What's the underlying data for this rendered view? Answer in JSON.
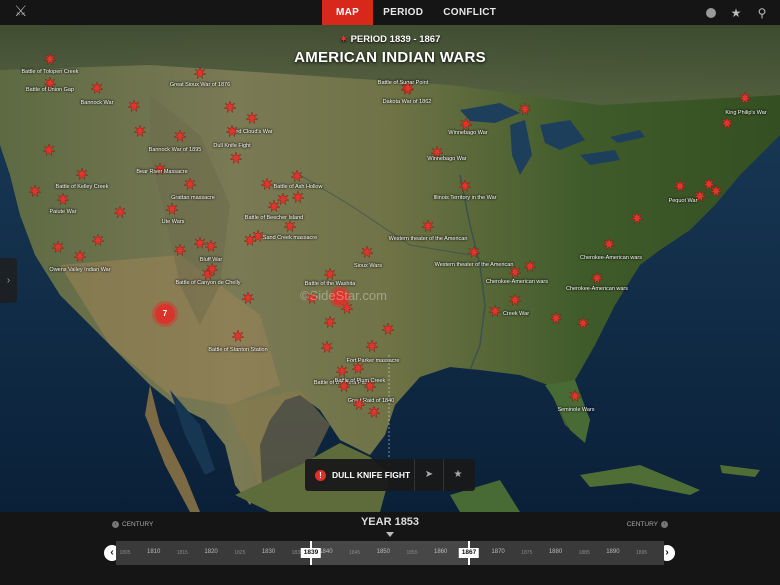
{
  "topbar": {
    "logo_icon": "spartan-helmet-icon",
    "tabs": [
      {
        "label": "MAP",
        "active": true
      },
      {
        "label": "PERIOD",
        "active": false
      },
      {
        "label": "CONFLICT",
        "active": false
      }
    ],
    "icons": [
      "info-icon",
      "favorites-star-icon",
      "search-icon"
    ]
  },
  "map": {
    "period_label": "PERIOD 1839 - 1867",
    "conflict_title": "AMERICAN INDIAN WARS",
    "watermark": "©SideStar.com",
    "cluster_count": "7",
    "accent_color": "#d8281c",
    "labels": [
      "Battle of Tolopen Creek",
      "Battle of Union Gap",
      "Bannock War",
      "Great Sioux War of 1876",
      "Battle of Sugar Point",
      "Dakota War of 1862",
      "King Philip's War",
      "Red Cloud's War",
      "Dull Knife Fight",
      "Bannock War of 1895",
      "Winnebago War",
      "Winnebago War",
      "Bear River Massacre",
      "Grattan massacre",
      "Battle of Kelley Creek",
      "Paiute War",
      "Ute Wars",
      "Battle of Ash Hollow",
      "Battle of Beecher Island",
      "Sand Creek massacre",
      "Illinois Territory in the War",
      "Western theater of the American",
      "Western theater of the American",
      "Pequot War",
      "Sioux Wars",
      "Owens Valley Indian War",
      "Bluff War",
      "Battle of Canyon de Chelly",
      "Cherokee-American wars",
      "Cherokee-American wars",
      "Cherokee-American wars",
      "Creek War",
      "Battle of the Washita",
      "Battle of Stanton Station",
      "Fort Parker massacre",
      "Battle of Bandera Pass",
      "Battle of Plum Creek",
      "Great Raid of 1840",
      "Seminole Wars"
    ]
  },
  "popup": {
    "title": "DULL KNIFE FIGHT",
    "warn_icon": "alert-icon",
    "locate_icon": "locate-arrow-icon",
    "favorite_icon": "star-icon"
  },
  "timeline": {
    "year_label": "YEAR 1853",
    "century_left": "CENTURY",
    "century_right": "CENTURY",
    "start_year": "1839",
    "end_year": "1867",
    "ticks": [
      "1805",
      "1810",
      "1815",
      "1820",
      "1825",
      "1830",
      "1835",
      "1840",
      "1845",
      "1850",
      "1855",
      "1860",
      "1865",
      "1870",
      "1875",
      "1880",
      "1885",
      "1890",
      "1895"
    ]
  }
}
